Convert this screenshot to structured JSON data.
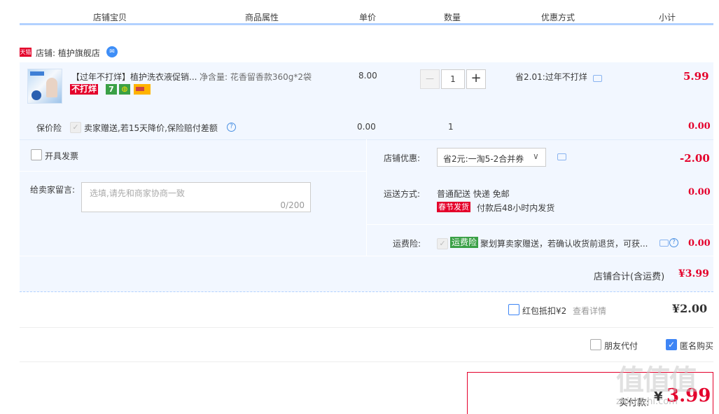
{
  "header": {
    "col_item": "店铺宝贝",
    "col_attr": "商品属性",
    "col_price": "单价",
    "col_qty": "数量",
    "col_discount": "优惠方式",
    "col_subtotal": "小计"
  },
  "shop": {
    "badge": "天猫",
    "label": "店铺: 植护旗舰店"
  },
  "item": {
    "title": "【过年不打烊】植护洗衣液促销...",
    "attr": "净含量: 花香留香款360g*2袋",
    "price": "8.00",
    "qty": "1",
    "qty_minus": "—",
    "qty_plus": "+",
    "discount": "省2.01:过年不打烊",
    "subtotal": "5.99",
    "tag_notclosed": "不打烊",
    "tag_7": "7"
  },
  "insurance": {
    "label": "保价险",
    "desc": "卖家赠送,若15天降价,保险赔付差额",
    "price": "0.00",
    "qty": "1",
    "subtotal": "0.00"
  },
  "invoice": {
    "label": "开具发票"
  },
  "message": {
    "label": "给卖家留言:",
    "placeholder": "选填,请先和商家协商一致",
    "counter": "0/200"
  },
  "shop_discount": {
    "label": "店铺优惠:",
    "selected": "省2元:一淘5-2合并券",
    "amount": "-2.00"
  },
  "shipping": {
    "label": "运送方式:",
    "method": "普通配送 快递 免邮",
    "tag": "春节发货",
    "note": "付款后48小时内发货",
    "amount": "0.00"
  },
  "freight_insurance": {
    "label": "运费险:",
    "tag": "运费险",
    "desc": "聚划算卖家赠送，若确认收货前退货，可获...",
    "amount": "0.00"
  },
  "shop_total": {
    "label": "店铺合计(含运费)",
    "amount": "¥3.99"
  },
  "redpacket": {
    "label": "红包抵扣¥2",
    "link": "查看详情",
    "amount": "¥2.00"
  },
  "options": {
    "friend_pay": "朋友代付",
    "anonymous": "匿名购买"
  },
  "pay": {
    "label": "实付款:",
    "currency": "¥",
    "amount": "3.99"
  },
  "watermark": {
    "logo": "值值值",
    "site": "zhizhizhi.com"
  },
  "colors": {
    "accent_red": "#e4002b",
    "panel_blue": "#f2f7ff",
    "header_line": "#b2d1ff",
    "tag_green": "#3aa046"
  }
}
